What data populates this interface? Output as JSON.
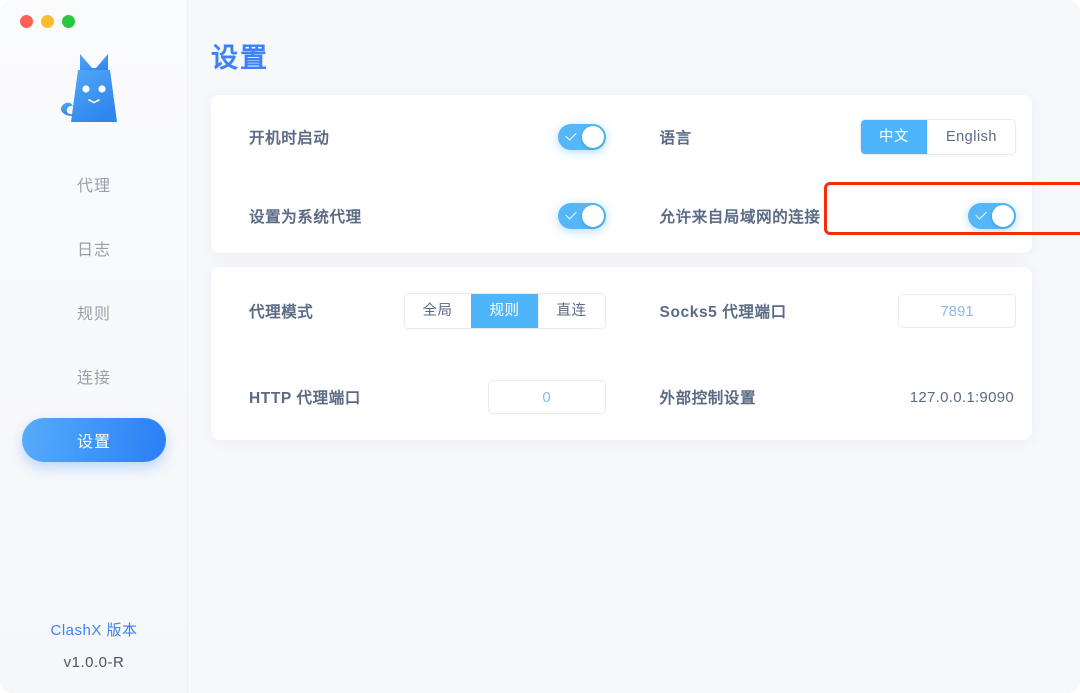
{
  "window": {
    "traffic_lights": [
      {
        "name": "close",
        "color": "#ff6159"
      },
      {
        "name": "minimize",
        "color": "#fbbd2e"
      },
      {
        "name": "zoom",
        "color": "#29c740"
      }
    ]
  },
  "sidebar": {
    "logo_icon": "clash-cat-logo-icon",
    "items": [
      {
        "label": "代理",
        "active": false
      },
      {
        "label": "日志",
        "active": false
      },
      {
        "label": "规则",
        "active": false
      },
      {
        "label": "连接",
        "active": false
      },
      {
        "label": "设置",
        "active": true
      }
    ],
    "footer": {
      "version_label": "ClashX 版本",
      "version_number": "v1.0.0-R"
    }
  },
  "main": {
    "title": "设置",
    "card1": {
      "startup": {
        "label": "开机时启动",
        "toggle_on": true
      },
      "system_proxy": {
        "label": "设置为系统代理",
        "toggle_on": true
      },
      "language": {
        "label": "语言",
        "options": [
          "中文",
          "English"
        ],
        "selected": "中文"
      },
      "allow_lan": {
        "label": "允许来自局域网的连接",
        "toggle_on": true,
        "highlighted": true
      }
    },
    "card2": {
      "proxy_mode": {
        "label": "代理模式",
        "options": [
          "全局",
          "规则",
          "直连"
        ],
        "selected": "规则"
      },
      "http_port": {
        "label": "HTTP 代理端口",
        "value": "0"
      },
      "socks5_port": {
        "label": "Socks5 代理端口",
        "value": "7891"
      },
      "external_controller": {
        "label": "外部控制设置",
        "value": "127.0.0.1:9090"
      }
    }
  },
  "colors": {
    "accent_blue": "#3b82f6",
    "toggle_blue": "#55b6f8",
    "segment_active": "#4fb5fa",
    "highlight_red": "#f52d0b",
    "label_gray": "#5b6b84",
    "nav_gray": "#9aa0ab"
  }
}
